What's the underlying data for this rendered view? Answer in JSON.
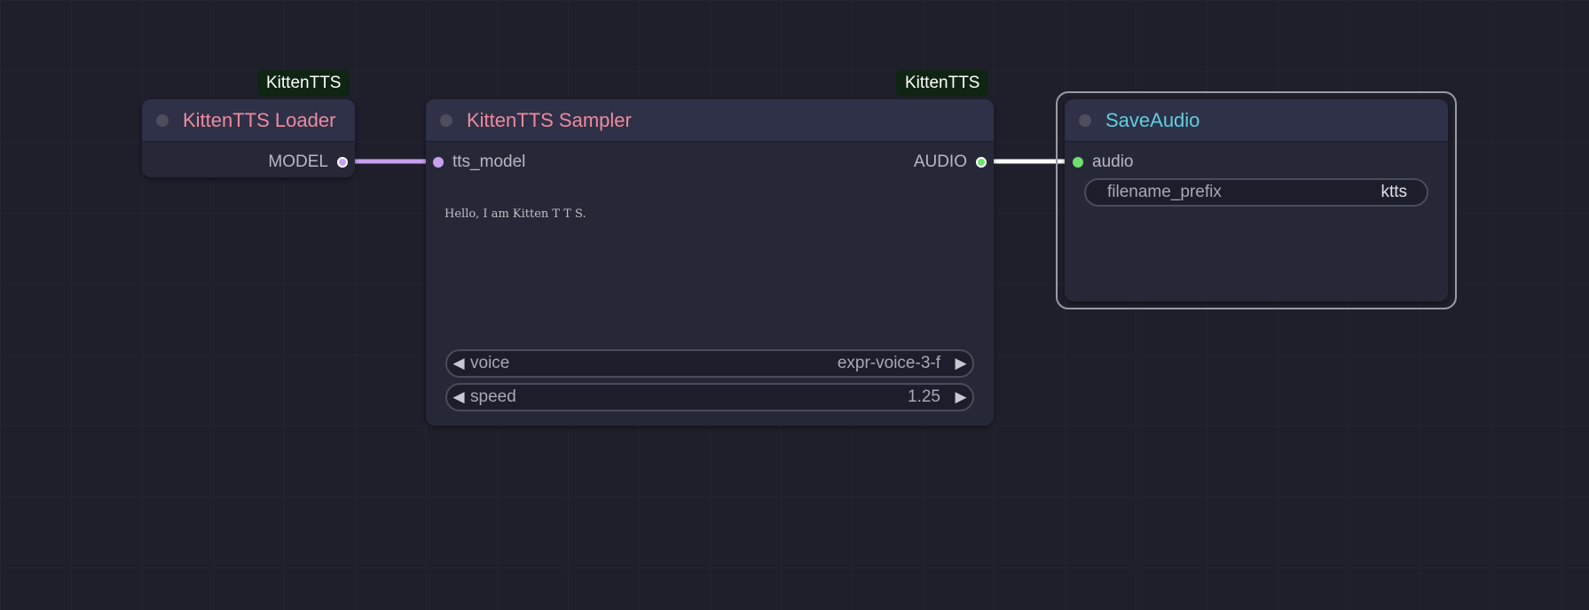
{
  "nodes": {
    "loader": {
      "badge": "KittenTTS",
      "title": "KittenTTS Loader",
      "output_label": "MODEL"
    },
    "sampler": {
      "badge": "KittenTTS",
      "title": "KittenTTS Sampler",
      "input_label": "tts_model",
      "output_label": "AUDIO",
      "text": "Hello, I am Kitten T T S.",
      "voice_label": "voice",
      "voice_value": "expr-voice-3-f",
      "speed_label": "speed",
      "speed_value": "1.25"
    },
    "save_audio": {
      "title": "SaveAudio",
      "input_label": "audio",
      "filename_label": "filename_prefix",
      "filename_value": "ktts"
    }
  },
  "icons": {
    "decrement": "◀",
    "increment": "▶"
  },
  "colors": {
    "model_link": "#c9a0f0",
    "audio_link": "#ffffff",
    "model_dot": "#c9a0f0",
    "audio_dot": "#6fe06f",
    "title_pink": "#f08a9e",
    "title_cyan": "#5fd0de",
    "badge_bg": "#0f2412"
  }
}
